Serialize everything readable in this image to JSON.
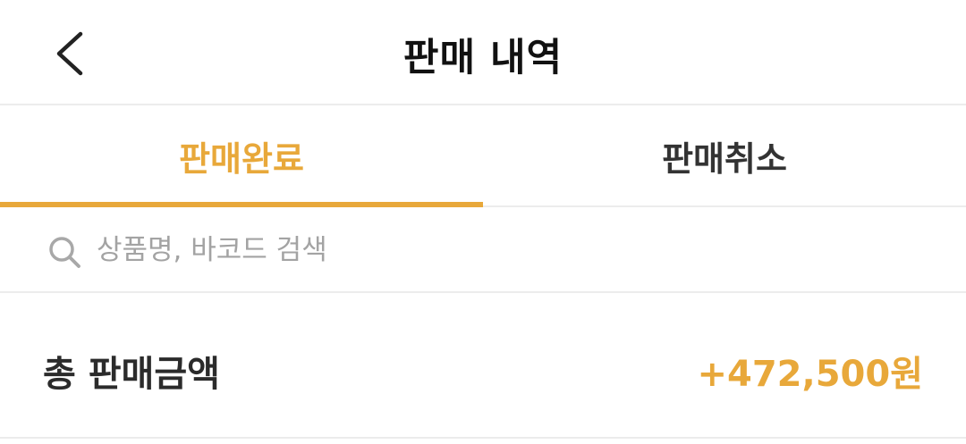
{
  "header": {
    "title": "판매 내역",
    "back_icon": "chevron-left-icon"
  },
  "tabs": [
    {
      "label": "판매완료",
      "active": true
    },
    {
      "label": "판매취소",
      "active": false
    }
  ],
  "search": {
    "placeholder": "상품명, 바코드 검색",
    "value": "",
    "icon": "search-icon"
  },
  "summary": {
    "label": "총 판매금액",
    "amount": "+472,500원"
  },
  "colors": {
    "accent": "#e8a83a",
    "text_dark": "#222222",
    "divider": "#ececec",
    "placeholder": "#a3a3a3"
  }
}
